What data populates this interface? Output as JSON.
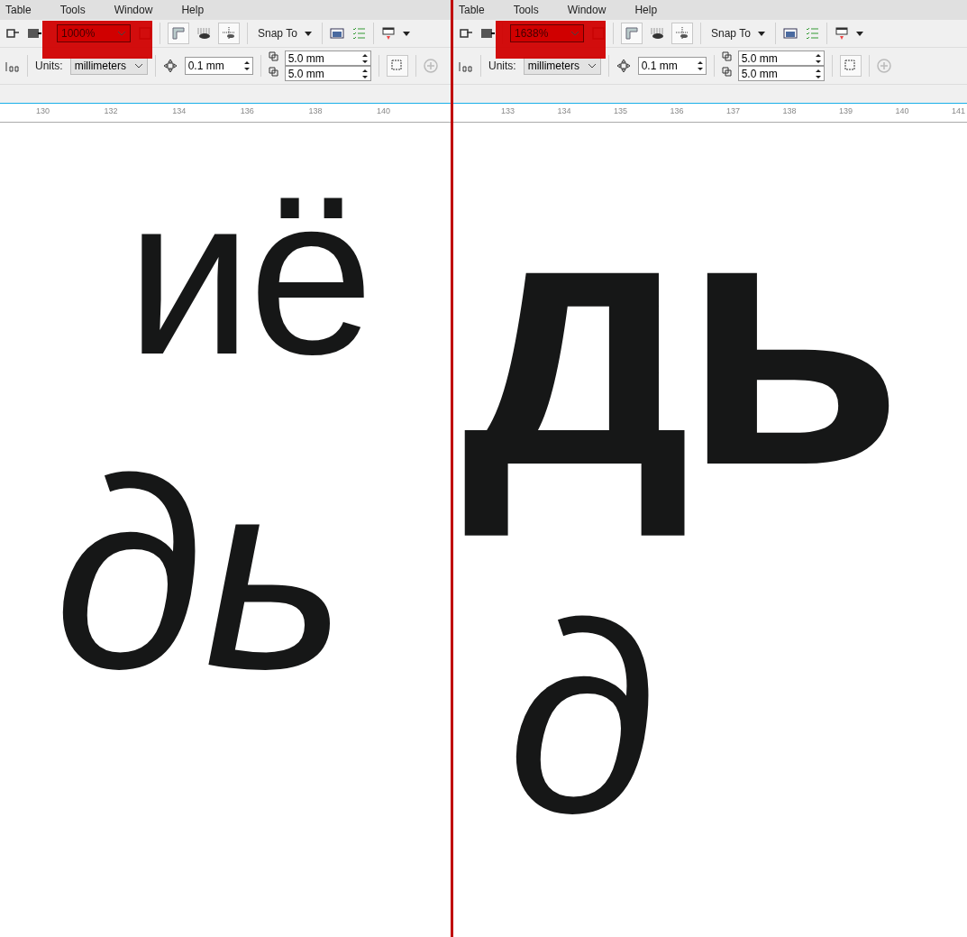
{
  "panes": [
    {
      "menu": [
        "Table",
        "Tools",
        "Window",
        "Help"
      ],
      "zoom": "1000%",
      "snap_to": "Snap To",
      "units_label": "Units:",
      "units": "millimeters",
      "nudge": "0.1 mm",
      "duplicate_x": "5.0 mm",
      "duplicate_y": "5.0 mm",
      "highlighted": true,
      "ruler": [
        "130",
        "132",
        "134",
        "136",
        "138",
        "140"
      ],
      "canvas_lines": [
        {
          "text": "иё",
          "kind": "light"
        },
        {
          "text": "дь",
          "kind": "italic"
        }
      ]
    },
    {
      "menu": [
        "Table",
        "Tools",
        "Window",
        "Help"
      ],
      "zoom": "1638%",
      "snap_to": "Snap To",
      "units_label": "Units:",
      "units": "millimeters",
      "nudge": "0.1 mm",
      "duplicate_x": "5.0 mm",
      "duplicate_y": "5.0 mm",
      "highlighted": true,
      "ruler": [
        "133",
        "134",
        "135",
        "136",
        "137",
        "138",
        "139",
        "140",
        "141"
      ],
      "canvas_lines": [
        {
          "text": "дь",
          "kind": "bold"
        },
        {
          "text": "д",
          "kind": "italic"
        }
      ]
    }
  ]
}
